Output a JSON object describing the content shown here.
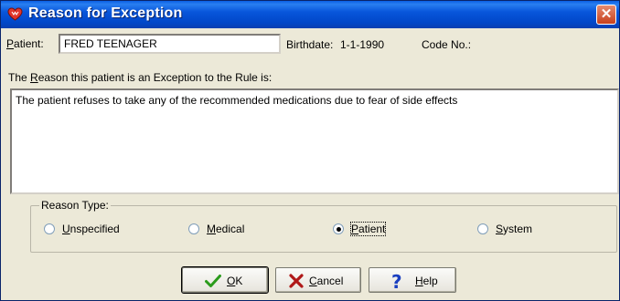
{
  "window": {
    "title": "Reason for Exception",
    "close_glyph": "✕"
  },
  "patient": {
    "label_u": "P",
    "label_rest": "atient:",
    "name": "FRED TEENAGER",
    "birthdate_label": "Birthdate:",
    "birthdate": "1-1-1990",
    "code_label": "Code No.:"
  },
  "reason": {
    "prompt_pre": "The ",
    "prompt_u": "R",
    "prompt_post": "eason this patient is an Exception to the Rule is:",
    "text": "The patient refuses to take any of the recommended medications due to fear of side effects"
  },
  "reason_type": {
    "legend": "Reason Type:",
    "options": [
      {
        "u": "U",
        "rest": "nspecified",
        "selected": false
      },
      {
        "u": "M",
        "rest": "edical",
        "selected": false
      },
      {
        "u": "P",
        "rest": "atient",
        "selected": true
      },
      {
        "u": "S",
        "rest": "ystem",
        "selected": false
      }
    ]
  },
  "buttons": {
    "ok": {
      "u": "O",
      "rest": "K",
      "icon": "checkmark-icon",
      "color": "#2a9b1c"
    },
    "cancel": {
      "u": "C",
      "rest": "ancel",
      "icon": "x-icon",
      "color": "#b01818"
    },
    "help": {
      "u": "H",
      "rest": "elp",
      "icon": "question-icon",
      "color": "#1a3fc0"
    }
  },
  "colors": {
    "titlebar": "#0856db",
    "face": "#ece9d8",
    "close": "#c8401c"
  }
}
